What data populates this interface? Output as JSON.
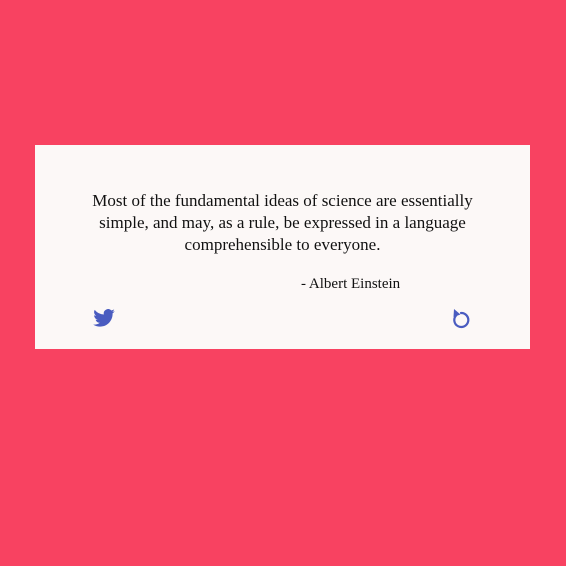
{
  "page": {
    "background_color": "#f84261"
  },
  "card": {
    "background_color": "#fcf8f7",
    "quote_text": "Most of the fundamental ideas of science are essentially simple, and may, as a rule, be expressed in a language comprehensible to everyone.",
    "author_text": "- Albert Einstein",
    "icon_color": "#4a5cc0",
    "tweet_icon": "twitter-bird-icon",
    "new_quote_icon": "refresh-icon"
  }
}
